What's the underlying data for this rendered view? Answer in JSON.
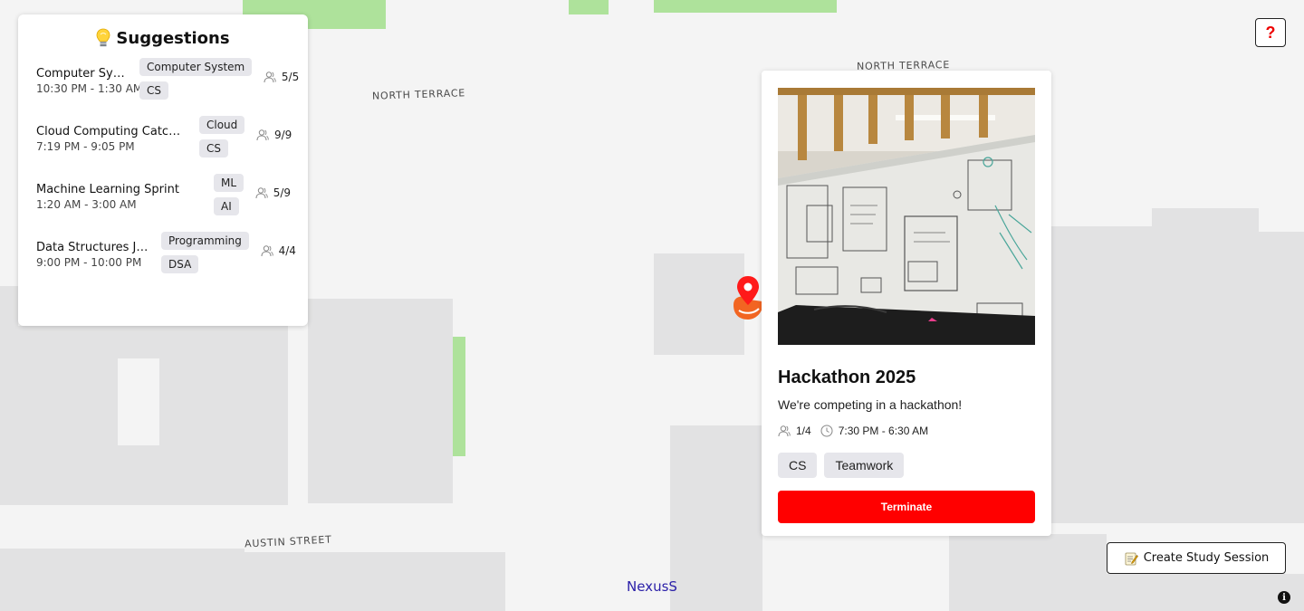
{
  "map": {
    "streets": {
      "north_terrace_1": "NORTH TERRACE",
      "north_terrace_2": "NORTH TERRACE",
      "austin_street": "AUSTIN STREET"
    },
    "brand": "NexusS"
  },
  "suggestions": {
    "icon": "lightbulb-icon",
    "title": "Suggestions",
    "items": [
      {
        "name": "Computer Sy…",
        "time": "10:30 PM - 1:30 AM",
        "tags": [
          "Computer System",
          "CS"
        ],
        "count": "5/5"
      },
      {
        "name": "Cloud Computing Catc…",
        "time": "7:19 PM - 9:05 PM",
        "tags": [
          "Cloud",
          "CS"
        ],
        "count": "9/9"
      },
      {
        "name": "Machine Learning Sprint",
        "time": "1:20 AM - 3:00 AM",
        "tags": [
          "ML",
          "AI"
        ],
        "count": "5/9"
      },
      {
        "name": "Data Structures J…",
        "time": "9:00 PM - 10:00 PM",
        "tags": [
          "Programming",
          "DSA"
        ],
        "count": "4/4"
      }
    ]
  },
  "session": {
    "title": "Hackathon 2025",
    "description": "We're competing in a hackathon!",
    "participants": "1/4",
    "time": "7:30 PM - 6:30 AM",
    "tags": [
      "CS",
      "Teamwork"
    ],
    "terminate_label": "Terminate"
  },
  "controls": {
    "help_label": "?",
    "create_label": "Create Study Session",
    "create_icon": "memo-icon",
    "info_label": "i"
  },
  "colors": {
    "accent_red": "#ff0000",
    "marker_orange": "#f26522",
    "brand_blue": "#2a1fa8",
    "park_green": "#aee29b"
  }
}
